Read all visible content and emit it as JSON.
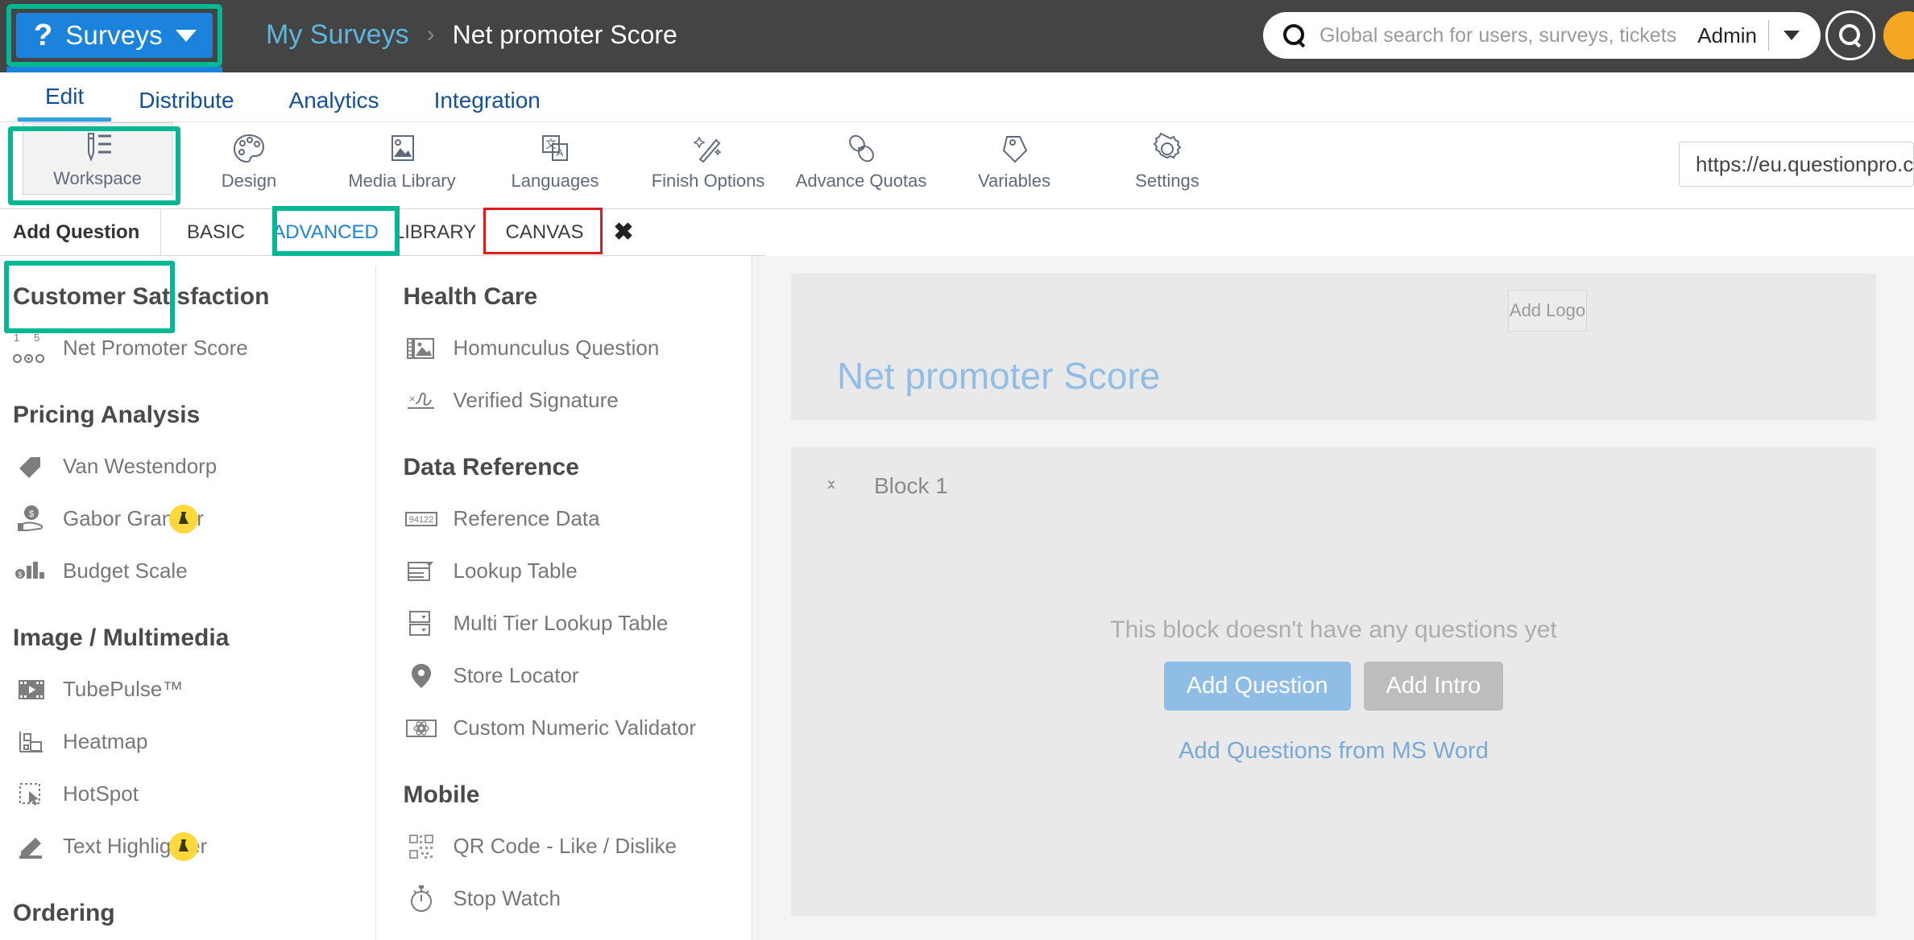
{
  "topbar": {
    "brand": {
      "logo_glyph": "?",
      "label": "Surveys",
      "caret": "▼"
    },
    "breadcrumb": {
      "parent": "My Surveys",
      "separator": "›",
      "current": "Net promoter Score"
    },
    "search": {
      "placeholder": "Global search for users, surveys, tickets",
      "value": ""
    },
    "admin_label": "Admin",
    "accent_teal": "#00b894",
    "brand_blue": "#1c83dd",
    "bar_bg": "#444444"
  },
  "navtabs": [
    {
      "label": "Edit",
      "active": true
    },
    {
      "label": "Distribute",
      "active": false
    },
    {
      "label": "Analytics",
      "active": false
    },
    {
      "label": "Integration",
      "active": false
    }
  ],
  "toolbar": {
    "items": [
      {
        "label": "Workspace",
        "icon": "pen-list-icon",
        "selected": true
      },
      {
        "label": "Design",
        "icon": "palette-icon",
        "selected": false
      },
      {
        "label": "Media Library",
        "icon": "image-icon",
        "selected": false
      },
      {
        "label": "Languages",
        "icon": "translate-icon",
        "selected": false
      },
      {
        "label": "Finish Options",
        "icon": "magic-wand-icon",
        "selected": false
      },
      {
        "label": "Advance Quotas",
        "icon": "chain-link-icon",
        "selected": false
      },
      {
        "label": "Variables",
        "icon": "tag-icon",
        "selected": false
      },
      {
        "label": "Settings",
        "icon": "gear-icon",
        "selected": false
      }
    ],
    "url_value": "https://eu.questionpro.c"
  },
  "subtabs": {
    "add_question_label": "Add Question",
    "tabs": [
      {
        "label": "BASIC",
        "active": false
      },
      {
        "label": "ADVANCED",
        "active": true
      },
      {
        "label": "LIBRARY",
        "active": false
      },
      {
        "label": "CANVAS",
        "active": false
      }
    ],
    "close_glyph": "✖"
  },
  "panel": {
    "column_left": [
      {
        "section": "Customer Satisfaction",
        "items": [
          {
            "label": "Net Promoter Score",
            "icon": "nps-scale-icon",
            "beta": false,
            "scale_min": "1",
            "scale_max": "5"
          }
        ]
      },
      {
        "section": "Pricing Analysis",
        "items": [
          {
            "label": "Van Westendorp",
            "icon": "price-tag-icon",
            "beta": false
          },
          {
            "label": "Gabor Granger",
            "icon": "hand-coin-icon",
            "beta": true
          },
          {
            "label": "Budget Scale",
            "icon": "bar-chart-dollar-icon",
            "beta": false
          }
        ]
      },
      {
        "section": "Image / Multimedia",
        "items": [
          {
            "label": "TubePulse™",
            "icon": "film-play-icon",
            "beta": false
          },
          {
            "label": "Heatmap",
            "icon": "heatmap-icon",
            "beta": false
          },
          {
            "label": "HotSpot",
            "icon": "cursor-select-icon",
            "beta": false
          },
          {
            "label": "Text Highlighter",
            "icon": "highlighter-icon",
            "beta": true
          }
        ]
      },
      {
        "section": "Ordering",
        "items": []
      }
    ],
    "column_right": [
      {
        "section": "Health Care",
        "items": [
          {
            "label": "Homunculus Question",
            "icon": "picture-frame-icon",
            "beta": false
          },
          {
            "label": "Verified Signature",
            "icon": "signature-icon",
            "beta": true
          }
        ]
      },
      {
        "section": "Data Reference",
        "items": [
          {
            "label": "Reference Data",
            "icon": "zipcode-box-icon",
            "beta": false,
            "icon_text": "94122"
          },
          {
            "label": "Lookup Table",
            "icon": "lookup-table-icon",
            "beta": false
          },
          {
            "label": "Multi Tier Lookup Table",
            "icon": "multi-tier-dropdown-icon",
            "beta": false
          },
          {
            "label": "Store Locator",
            "icon": "map-pin-icon",
            "beta": false
          },
          {
            "label": "Custom Numeric Validator",
            "icon": "atom-box-icon",
            "beta": false
          }
        ]
      },
      {
        "section": "Mobile",
        "items": [
          {
            "label": "QR Code - Like / Dislike",
            "icon": "qr-code-icon",
            "beta": false
          },
          {
            "label": "Stop Watch",
            "icon": "stopwatch-icon",
            "beta": false
          }
        ]
      }
    ]
  },
  "canvas": {
    "add_logo_label": "Add Logo",
    "survey_title": "Net promoter Score",
    "block_name": "Block 1",
    "empty_message": "This block doesn't have any questions yet",
    "add_question_button": "Add Question",
    "add_intro_button": "Add Intro",
    "ms_word_link": "Add Questions from MS Word"
  }
}
